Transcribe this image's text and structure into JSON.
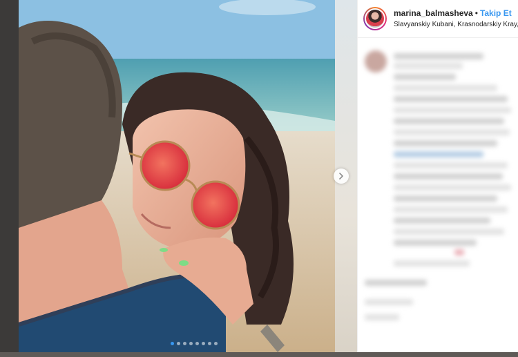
{
  "post": {
    "username": "marina_balmasheva",
    "separator": "•",
    "follow_label": "Takip Et",
    "location": "Slavyanskiy Kubani, Krasnodarskiy Kray,"
  },
  "carousel": {
    "slide_count": 8,
    "active_index": 0
  },
  "colors": {
    "accent": "#3897f0",
    "text": "#262626"
  },
  "icons": {
    "next": "chevron-right-icon"
  }
}
